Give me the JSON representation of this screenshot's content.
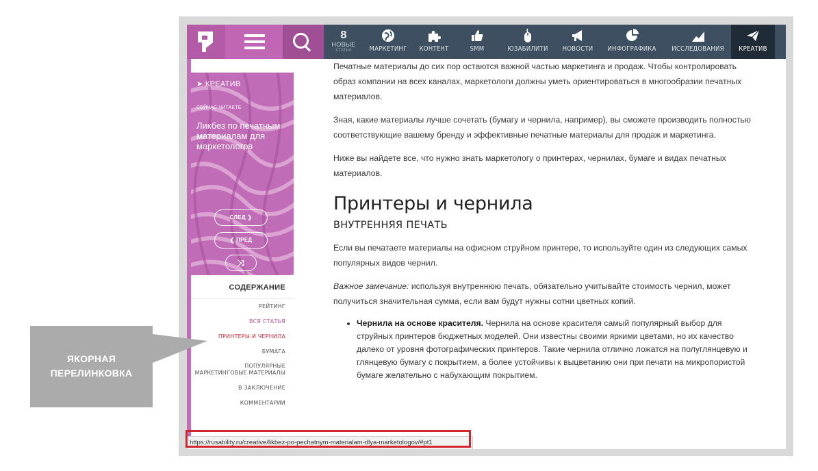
{
  "nav": {
    "new_count": "8",
    "new_label": "НОВЫЕ",
    "new_sub": "СТАТЬИ",
    "items": [
      {
        "label": "МАРКЕТИНГ",
        "icon": "globe-icon"
      },
      {
        "label": "КОНТЕНТ",
        "icon": "puzzle-icon"
      },
      {
        "label": "SMM",
        "icon": "thumbs-up-icon"
      },
      {
        "label": "ЮЗАБИЛИТИ",
        "icon": "mouse-icon"
      },
      {
        "label": "НОВОСТИ",
        "icon": "megaphone-icon"
      },
      {
        "label": "ИНФОГРАФИКА",
        "icon": "pie-chart-icon"
      },
      {
        "label": "ИССЛЕДОВАНИЯ",
        "icon": "growth-chart-icon"
      },
      {
        "label": "КРЕАТИВ",
        "icon": "paper-plane-icon"
      }
    ]
  },
  "sidebar": {
    "category": "КРЕАТИВ",
    "reading_label": "СЕЙЧАС ЧИТАЕТЕ",
    "article_title": "Ликбез по печатным материалам для маркетологов",
    "next_label": "СЛЕД",
    "prev_label": "ПРЕД",
    "toc_title": "СОДЕРЖАНИЕ",
    "toc": [
      "РЕЙТИНГ",
      "ВСЯ СТАТЬЯ",
      "ПРИНТЕРЫ И ЧЕРНИЛА",
      "БУМАГА",
      "ПОПУЛЯРНЫЕ МАРКЕТИНГОВЫЕ МАТЕРИАЛЫ",
      "В ЗАКЛЮЧЕНИЕ",
      "КОММЕНТАРИИ"
    ]
  },
  "article": {
    "p1": "Печатные материалы до сих пор остаются важной частью маркетинга и продаж. Чтобы контролировать образ компании на всех каналах, маркетологи должны уметь ориентироваться в многообразии печатных материалов.",
    "p2": "Зная, какие материалы лучше сочетать (бумагу и чернила, например), вы сможете производить полностью соответствующие вашему бренду и эффективные печатные материалы для продаж и маркетинга.",
    "p3": "Ниже вы найдете все, что нужно знать маркетологу о принтерах, чернилах, бумаге и видах печатных материалов.",
    "h2": "Принтеры и чернила",
    "h3": "ВНУТРЕННЯЯ ПЕЧАТЬ",
    "p4": "Если вы печатаете материалы на офисном струйном принтере, то используйте один из следующих самых популярных видов чернил.",
    "note_label": "Важное замечание:",
    "note_text": " используя внутреннюю печать, обязательно учитывайте стоимость чернил, может получиться значительная сумма, если вам будут нужны сотни цветных копий.",
    "li_bold": "Чернила на основе красителя.",
    "li_text": " Чернила на основе красителя самый популярный выбор для струйных принтеров бюджетных моделей. Они известны своими яркими цветами, но их качество далеко от уровня фотографических принтеров. Такие чернила отлично ложатся на полуглянцевую и глянцевую бумагу с покрытием, а более устойчивы к выцветанию они при печати на микропористой бумаге желательно с набухающим покрытием."
  },
  "status_url": "https://rusability.ru/creative/likbez-po-pechatnym-materialam-dlya-marketologov/#pt1",
  "callout": {
    "line1": "ЯКОРНАЯ",
    "line2": "ПЕРЕЛИНКОВКА"
  },
  "colors": {
    "brand_pink": "#c16cb6",
    "nav_bg": "#3d4f60",
    "highlight_red": "#d0262e"
  }
}
